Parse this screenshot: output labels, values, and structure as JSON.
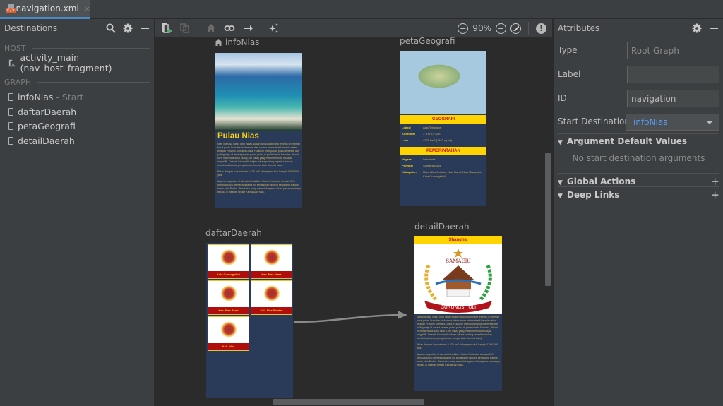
{
  "editor_tab": {
    "filename": "navigation.xml",
    "close_glyph": "×",
    "icon": "xml-file-icon"
  },
  "destinations_panel": {
    "title": "Destinations",
    "icons": [
      "search-icon",
      "gear-icon",
      "minimize-icon"
    ],
    "sections": [
      {
        "label": "HOST",
        "items": [
          {
            "name": "activity_main (nav_host_fragment)",
            "icon": "host-activity-icon"
          }
        ]
      },
      {
        "label": "GRAPH",
        "items": [
          {
            "name": "infoNias",
            "suffix": " - Start",
            "icon": "fragment-icon"
          },
          {
            "name": "daftarDaerah",
            "suffix": "",
            "icon": "fragment-icon"
          },
          {
            "name": "petaGeografi",
            "suffix": "",
            "icon": "fragment-icon"
          },
          {
            "name": "detailDaerah",
            "suffix": "",
            "icon": "fragment-icon"
          }
        ]
      }
    ]
  },
  "canvas_toolbar": {
    "tools": [
      "new-destination-icon",
      "nested-graph-icon",
      "assign-start-icon",
      "deep-link-icon",
      "auto-arrange-icon",
      "magic-wand-icon"
    ],
    "zoom_out": "−",
    "zoom_level": "90%",
    "zoom_in": "+",
    "zoom_fit": "fit-screen-icon",
    "warning": "!"
  },
  "graph": {
    "destinations": {
      "infoNias": {
        "label": "infoNias",
        "is_start": true,
        "title": "Pulau Nias",
        "body": "Nias (bahasa Nias: Tanö Niha) adalah kepulauan yang terletak di sebelah barat pulau Sumatra, Indonesia, dan secara administratif berada dalam wilayah Provinsi Sumatra Utara. Pulau ini merupakan pulau terbesar dan paling maju di antara jajaran pulau-pulau di pantai barat Sumatra, dihuni oleh mayoritas suku Nias (Ono Niha) yang masih memiliki budaya megalitik. Daerah ini memiliki objek wisata penting seperti selancar, rumah tradisional, penyelaman, lompat batu (lompat batu).",
        "body2": "Pulau dengan luas wilayah 5.625 km² ini berpenduduk hampir 1.000.000 jiwa.",
        "body3": "Agama mayoritas di daerah ini adalah Kristen Protestan dimana 90% penduduknya memeluk agama ini, sedangkan lainnya beragama Katolik, Islam, dan Budha. Penduduk yang memeluk agama Islam pada umumnya berada di wilayah pesisir Kepulauan Nias."
      },
      "petaGeografi": {
        "label": "petaGeografi",
        "section1": "GEOGRAFI",
        "geo": [
          {
            "k": "Lokasi",
            "v": "Asia Tenggara"
          },
          {
            "k": "Koordinat",
            "v": "1°6'N 97°32'E"
          },
          {
            "k": "Luas",
            "v": "4771 km2 (1842 sq mi)"
          }
        ],
        "section2": "PEMERINTAHAN",
        "gov": [
          {
            "k": "Negara",
            "v": "Indonesia"
          },
          {
            "k": "Provinsi",
            "v": "Sumatra Utara"
          },
          {
            "k": "Kabupaten",
            "v": "Nias, Nias Selatan, Nias Barat, Nias Utara, dan Kota Gunungsitoli"
          }
        ]
      },
      "daftarDaerah": {
        "label": "daftarDaerah",
        "cards": [
          "Kota Gunungsitoli",
          "Kab. Nias Utara",
          "Kab. Nias Barat",
          "Kab. Nias Selatan",
          "Kab. Nias"
        ]
      },
      "detailDaerah": {
        "label": "detailDaerah",
        "header": "Shanghai",
        "emblem_top": "SAMAERI",
        "emblem_ribbon": "GUNUNGSITOLI",
        "body": "Nias (bahasa Nias: Tanö Niha) adalah kepulauan yang terletak di sebelah barat pulau Sumatra, Indonesia, dan secara administratif berada dalam wilayah Provinsi Sumatra Utara. Pulau ini merupakan pulau terbesar dan paling maju di antara jajaran pulau-pulau di pantai barat Sumatra, dihuni oleh mayoritas suku Nias (Ono Niha) yang masih memiliki budaya megalitik. Daerah ini memiliki objek wisata penting seperti selancar, rumah tradisional, penyelaman, lompat batu (lompat batu).",
        "body2": "Pulau dengan luas wilayah 5.625 km² ini berpenduduk hampir 1.000.000 jiwa.",
        "body3": "Agama mayoritas di daerah ini adalah Kristen Protestan dimana 90% penduduknya memeluk agama ini, sedangkan lainnya beragama Katolik, Islam, dan Budha. Penduduk yang memeluk agama Islam pada umumnya berada di wilayah pesisir Kepulauan Nias."
      }
    },
    "actions": [
      {
        "from": "daftarDaerah",
        "to": "detailDaerah"
      }
    ]
  },
  "attributes_panel": {
    "title": "Attributes",
    "icons": [
      "gear-icon",
      "minimize-icon"
    ],
    "type_label": "Type",
    "type_value": "Root Graph",
    "label_label": "Label",
    "label_value": "",
    "id_label": "ID",
    "id_value": "navigation",
    "start_label": "Start Destination",
    "start_value": "infoNias",
    "sections": {
      "args": {
        "title": "Argument Default Values",
        "empty": "No start destination arguments"
      },
      "global_actions": {
        "title": "Global Actions",
        "add": "+"
      },
      "deep_links": {
        "title": "Deep Links",
        "add": "+"
      }
    },
    "collapse_glyph": "▼"
  },
  "colors": {
    "accent": "#4a88c7",
    "link": "#589df6",
    "screen_bg": "#2a3b5a",
    "title_yellow": "#ffd400",
    "banner_red": "#b00d0d"
  }
}
